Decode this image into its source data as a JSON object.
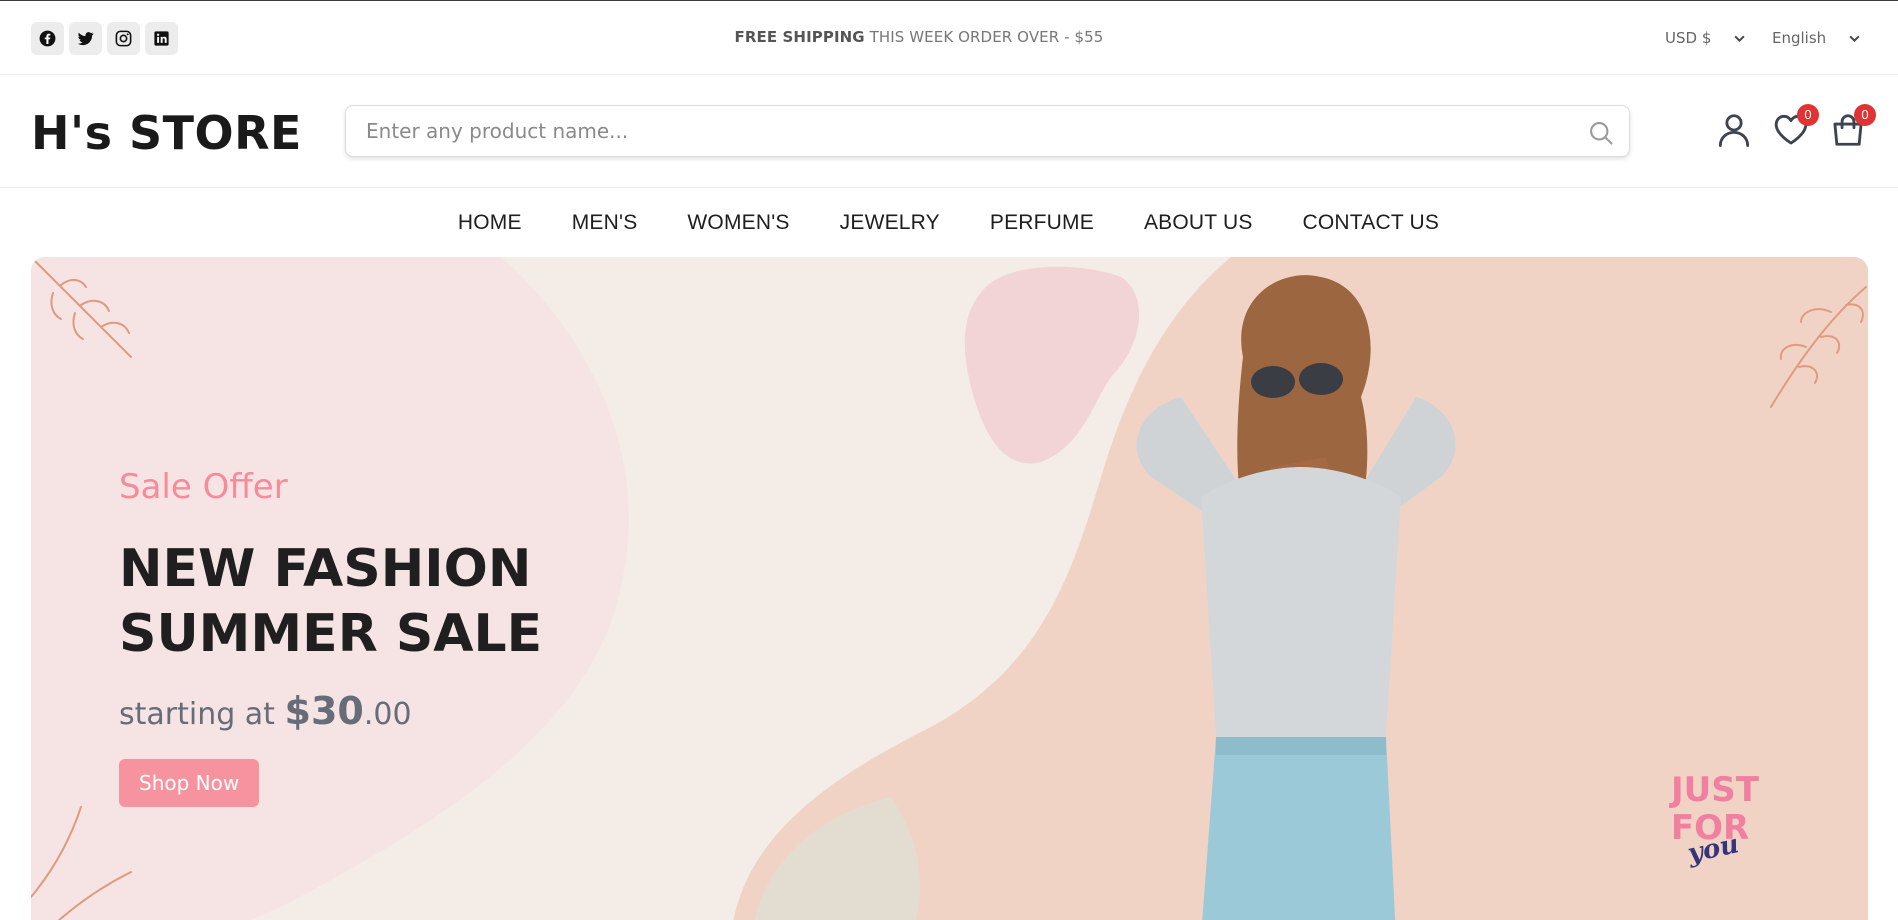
{
  "topbar": {
    "socials": [
      {
        "name": "facebook-icon"
      },
      {
        "name": "twitter-icon"
      },
      {
        "name": "instagram-icon"
      },
      {
        "name": "linkedin-icon"
      }
    ],
    "promo_bold": "FREE SHIPPING",
    "promo_rest": "THIS WEEK ORDER OVER - $55",
    "currency": "USD $",
    "language": "English"
  },
  "header": {
    "logo": "H's STORE",
    "search_placeholder": "Enter any product name...",
    "wishlist_count": "0",
    "cart_count": "0"
  },
  "nav": {
    "items": [
      "HOME",
      "MEN'S",
      "WOMEN'S",
      "JEWELRY",
      "PERFUME",
      "ABOUT US",
      "CONTACT US"
    ]
  },
  "banner": {
    "subtitle": "Sale Offer",
    "headline_line1": "NEW FASHION",
    "headline_line2": "SUMMER SALE",
    "price_prefix": "starting at",
    "price_main": "$30",
    "price_cents": ".00",
    "button_label": "Shop Now",
    "stamp_line1": "JUST",
    "stamp_line2": "FOR",
    "stamp_line3": "you"
  },
  "colors": {
    "accent_pink": "#f7939f",
    "badge_red": "#e03434",
    "banner_bg": "#f4ece6"
  }
}
